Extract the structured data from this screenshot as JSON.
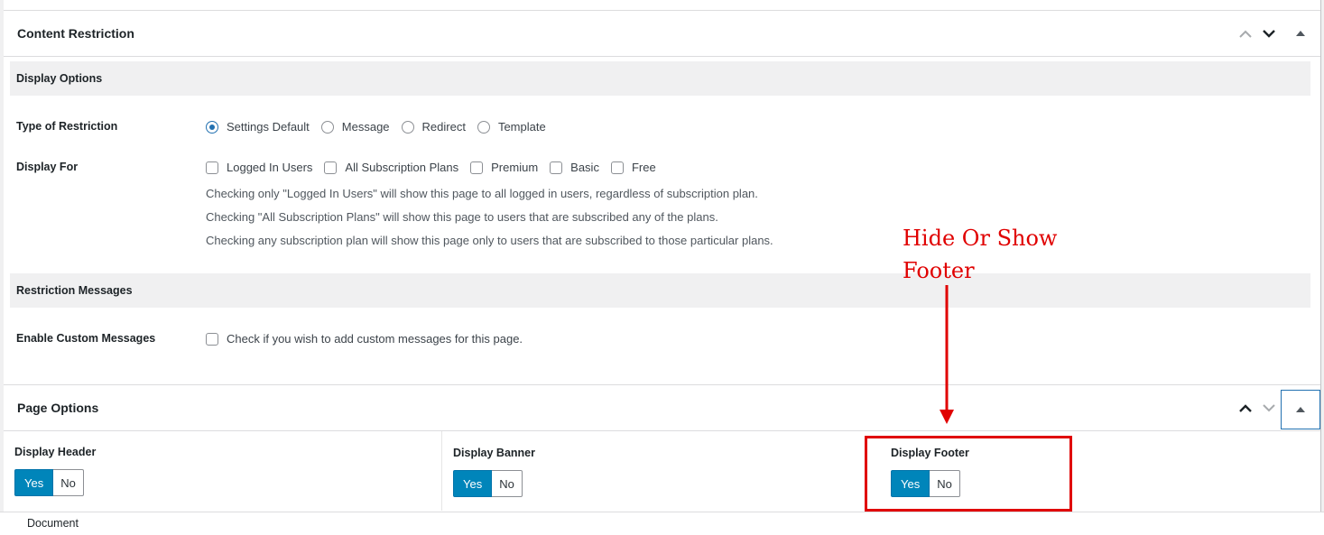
{
  "content_restriction": {
    "title": "Content Restriction",
    "icons": [
      "chevron-up-icon",
      "chevron-down-icon",
      "triangle-up-icon"
    ],
    "display_options": {
      "heading": "Display Options",
      "type_of_restriction": {
        "label": "Type of Restriction",
        "options": [
          "Settings Default",
          "Message",
          "Redirect",
          "Template"
        ],
        "selected": "Settings Default"
      },
      "display_for": {
        "label": "Display For",
        "options": [
          "Logged In Users",
          "All Subscription Plans",
          "Premium",
          "Basic",
          "Free"
        ],
        "help": [
          "Checking only \"Logged In Users\" will show this page to all logged in users, regardless of subscription plan.",
          "Checking \"All Subscription Plans\" will show this page to users that are subscribed any of the plans.",
          "Checking any subscription plan will show this page only to users that are subscribed to those particular plans."
        ]
      }
    },
    "restriction_messages": {
      "heading": "Restriction Messages",
      "enable_custom": {
        "label": "Enable Custom Messages",
        "checkbox_text": "Check if you wish to add custom messages for this page."
      }
    }
  },
  "page_options": {
    "title": "Page Options",
    "icons": [
      "chevron-up-icon",
      "chevron-down-icon",
      "triangle-up-icon"
    ],
    "fields": [
      {
        "label": "Display Header",
        "yes": "Yes",
        "no": "No",
        "value": "Yes"
      },
      {
        "label": "Display Banner",
        "yes": "Yes",
        "no": "No",
        "value": "Yes"
      },
      {
        "label": "Display Footer",
        "yes": "Yes",
        "no": "No",
        "value": "Yes"
      }
    ]
  },
  "annotation": {
    "text": "Hide Or Show Footer",
    "color": "#e00000"
  },
  "footer": {
    "breadcrumb": "Document"
  },
  "colors": {
    "accent": "#0085ba",
    "radio_selected": "#2271b1"
  }
}
